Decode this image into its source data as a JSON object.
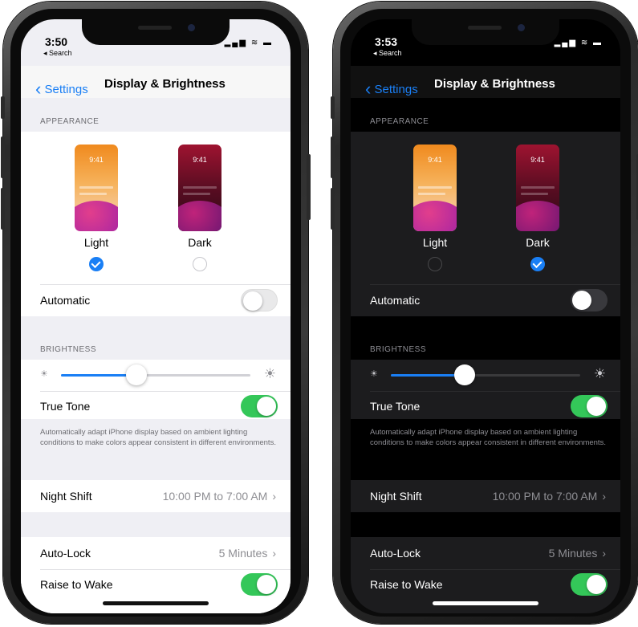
{
  "phones": [
    {
      "theme": "light",
      "status": {
        "time": "3:50",
        "back_app": "◂ Search",
        "icons": "▂▄▆ ≋ ▬"
      },
      "nav": {
        "back_label": "Settings",
        "title": "Display & Brightness"
      },
      "appearance": {
        "header": "APPEARANCE",
        "light": {
          "label": "Light",
          "thumb_time": "9:41",
          "selected": true
        },
        "dark": {
          "label": "Dark",
          "thumb_time": "9:41",
          "selected": false
        }
      },
      "automatic": {
        "label": "Automatic",
        "on": false
      },
      "brightness": {
        "header": "BRIGHTNESS",
        "level": 0.4
      },
      "true_tone": {
        "label": "True Tone",
        "on": true,
        "description": "Automatically adapt iPhone display based on ambient lighting conditions to make colors appear consistent in different environments."
      },
      "night_shift": {
        "label": "Night Shift",
        "value": "10:00 PM to 7:00 AM"
      },
      "auto_lock": {
        "label": "Auto-Lock",
        "value": "5 Minutes"
      },
      "raise_to_wake": {
        "label": "Raise to Wake",
        "on": true
      }
    },
    {
      "theme": "dark",
      "status": {
        "time": "3:53",
        "back_app": "◂ Search",
        "icons": "▂▄▆ ≋ ▬"
      },
      "nav": {
        "back_label": "Settings",
        "title": "Display & Brightness"
      },
      "appearance": {
        "header": "APPEARANCE",
        "light": {
          "label": "Light",
          "thumb_time": "9:41",
          "selected": false
        },
        "dark": {
          "label": "Dark",
          "thumb_time": "9:41",
          "selected": true
        }
      },
      "automatic": {
        "label": "Automatic",
        "on": false
      },
      "brightness": {
        "header": "BRIGHTNESS",
        "level": 0.39
      },
      "true_tone": {
        "label": "True Tone",
        "on": true,
        "description": "Automatically adapt iPhone display based on ambient lighting conditions to make colors appear consistent in different environments."
      },
      "night_shift": {
        "label": "Night Shift",
        "value": "10:00 PM to 7:00 AM"
      },
      "auto_lock": {
        "label": "Auto-Lock",
        "value": "5 Minutes"
      },
      "raise_to_wake": {
        "label": "Raise to Wake",
        "on": true
      }
    }
  ],
  "icons": {
    "back_chevron": "chevron-left-icon",
    "disclosure": "chevron-right-icon",
    "brightness_low": "sun-small-icon",
    "brightness_high": "sun-large-icon",
    "checkmark": "checkmark-icon"
  },
  "colors": {
    "accent": "#1a7ff5",
    "toggle_on": "#34c759",
    "light_thumb_top": "#f08a1e",
    "dark_thumb_top": "#9e1330"
  },
  "symbols": {
    "chevron_right": "›",
    "chevron_left": "‹",
    "sun": "☀"
  }
}
